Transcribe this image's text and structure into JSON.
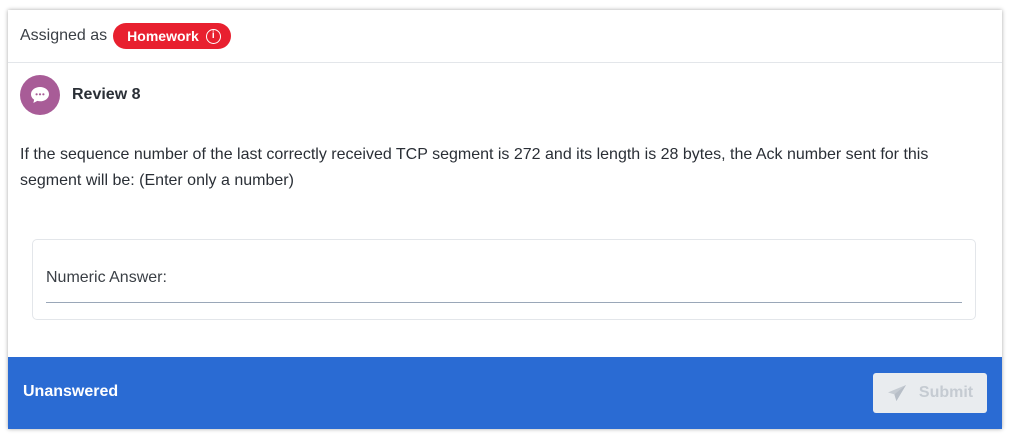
{
  "assignment": {
    "label": "Assigned as",
    "badge": "Homework",
    "info_icon": "info-icon",
    "badge_color": "#e8202f"
  },
  "review": {
    "title": "Review 8",
    "icon": "chat-bubble-icon",
    "avatar_color": "#a85c97"
  },
  "question": {
    "text": "If the sequence number of the last correctly received TCP segment is 272 and its length is 28 bytes, the Ack number sent for this segment will be: (Enter only a number)"
  },
  "answer": {
    "label": "Numeric Answer:",
    "value": ""
  },
  "footer": {
    "status": "Unanswered",
    "submit_label": "Submit",
    "submit_icon": "paper-plane-icon",
    "color": "#2a6bd3"
  }
}
